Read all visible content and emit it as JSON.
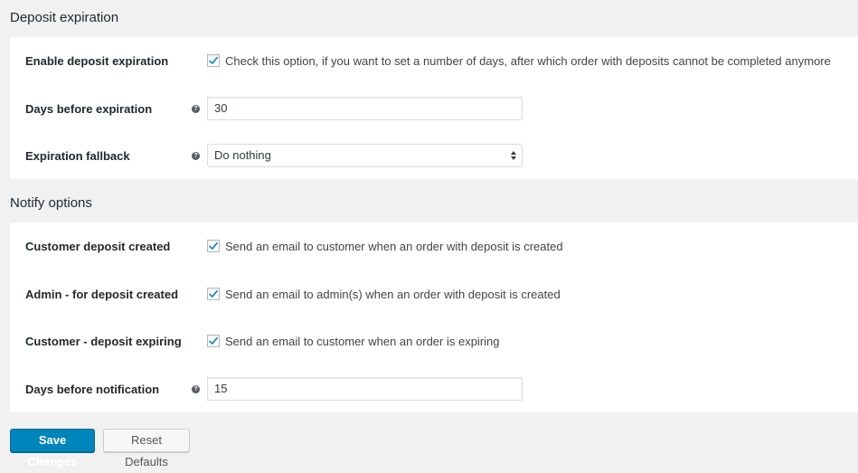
{
  "colors": {
    "page_bg": "#f1f1f1",
    "panel_bg": "#ffffff",
    "primary": "#0085ba",
    "checkmark": "#1e8cbe"
  },
  "expiration": {
    "title": "Deposit expiration",
    "rows": [
      {
        "label": "Enable deposit expiration",
        "type": "checkbox",
        "checked": true,
        "description": "Check this option, if you want to set a number of days, after which order with deposits cannot be completed anymore"
      },
      {
        "label": "Days before expiration",
        "type": "number",
        "help_icon": "question-circle-icon",
        "value": "30"
      },
      {
        "label": "Expiration fallback",
        "type": "select",
        "help_icon": "question-circle-icon",
        "value": "Do nothing"
      }
    ]
  },
  "notify": {
    "title": "Notify options",
    "rows": [
      {
        "label": "Customer deposit created",
        "type": "checkbox",
        "checked": true,
        "description": "Send an email to customer when an order with deposit is created"
      },
      {
        "label": "Admin - for deposit created",
        "type": "checkbox",
        "checked": true,
        "description": "Send an email to admin(s) when an order with deposit is created"
      },
      {
        "label": "Customer - deposit expiring",
        "type": "checkbox",
        "checked": true,
        "description": "Send an email to customer when an order is expiring"
      },
      {
        "label": "Days before notification",
        "type": "number",
        "help_icon": "question-circle-icon",
        "value": "15"
      }
    ]
  },
  "help_glyph": "?",
  "buttons": {
    "save": "Save Changes",
    "reset": "Reset Defaults"
  }
}
